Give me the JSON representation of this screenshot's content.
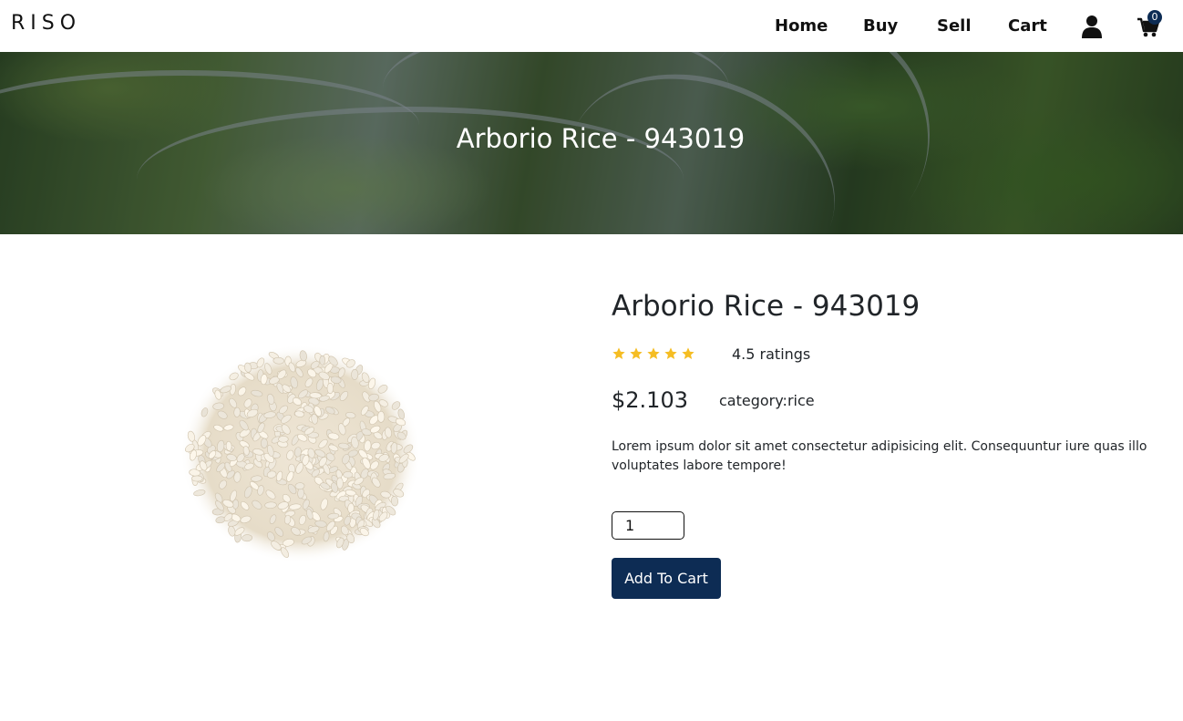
{
  "header": {
    "logo": "RISO",
    "nav": {
      "home": "Home",
      "buy": "Buy",
      "sell": "Sell",
      "cart": "Cart"
    },
    "icons": {
      "account": "user-icon",
      "cart": "shopping-cart-icon"
    },
    "cart_count": "0"
  },
  "banner": {
    "title": "Arborio Rice - 943019"
  },
  "product": {
    "title": "Arborio Rice - 943019",
    "image": "rice-grains-image",
    "stars": 5,
    "ratings_text": "4.5 ratings",
    "price": "$2.103",
    "category": "category:rice",
    "description": "Lorem ipsum dolor sit amet consectetur adipisicing elit. Consequuntur iure quas illo voluptates labore tempore!",
    "quantity": "1",
    "add_to_cart_label": "Add To Cart"
  },
  "colors": {
    "accent": "#0d2c54",
    "star": "#f5bd23",
    "text": "#212529"
  }
}
